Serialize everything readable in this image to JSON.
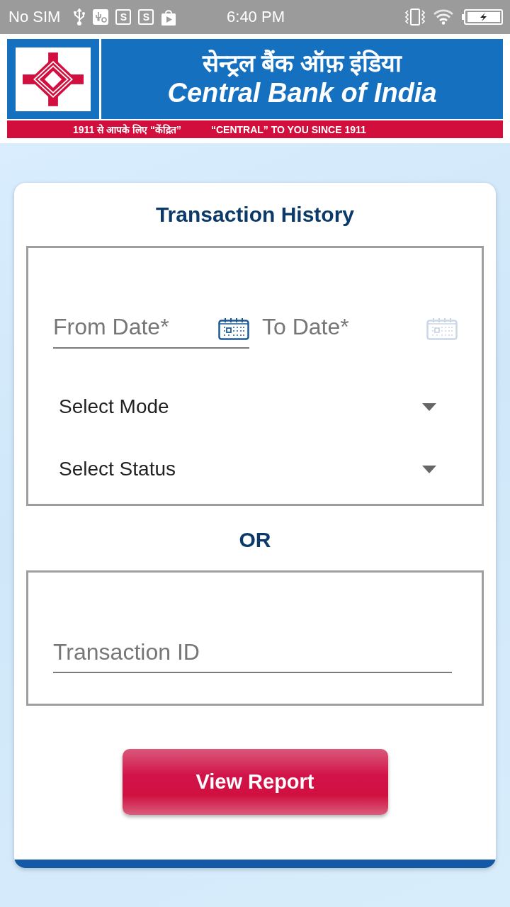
{
  "status_bar": {
    "carrier": "No SIM",
    "app_badges": [
      "S",
      "S"
    ],
    "time": "6:40 PM"
  },
  "banner": {
    "name_hindi": "सेन्ट्रल बैंक ऑफ़ इंडिया",
    "name_english": "Central Bank of India",
    "tagline_hindi": "1911 से आपके लिए “केंद्रित”",
    "tagline_english": "“CENTRAL” TO YOU SINCE 1911"
  },
  "form": {
    "title": "Transaction History",
    "date_fields": [
      {
        "placeholder": "From Date*",
        "disabled": false
      },
      {
        "placeholder": "To Date*",
        "disabled": true
      }
    ],
    "dropdowns": [
      {
        "label": "Select Mode"
      },
      {
        "label": "Select Status"
      }
    ],
    "separator": "OR",
    "transaction_id": {
      "placeholder": "Transaction ID"
    },
    "submit_button": "View Report"
  }
}
